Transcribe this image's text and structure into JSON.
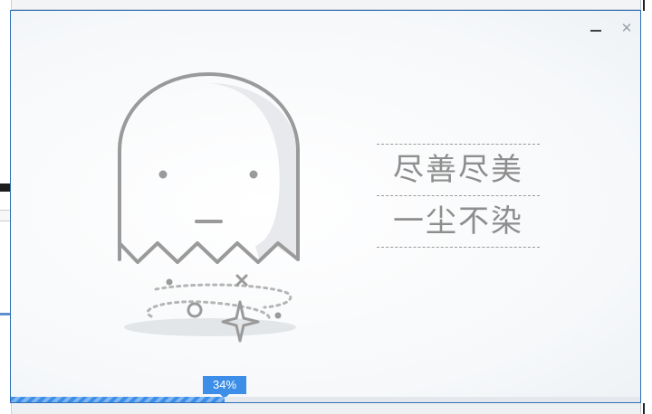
{
  "window": {
    "minimize_icon": "minimize-icon",
    "close_icon": "close-icon",
    "close_glyph": "✕"
  },
  "illustration": {
    "icon": "ghost-icon"
  },
  "slogan": {
    "line1": "尽善尽美",
    "line2": "一尘不染"
  },
  "progress": {
    "percent": 34,
    "label": "34%",
    "color": "#3d8ee8"
  },
  "colors": {
    "accent": "#3d8ee8",
    "window_border": "#2e6fb8",
    "text_gray": "#8e8e8e"
  }
}
